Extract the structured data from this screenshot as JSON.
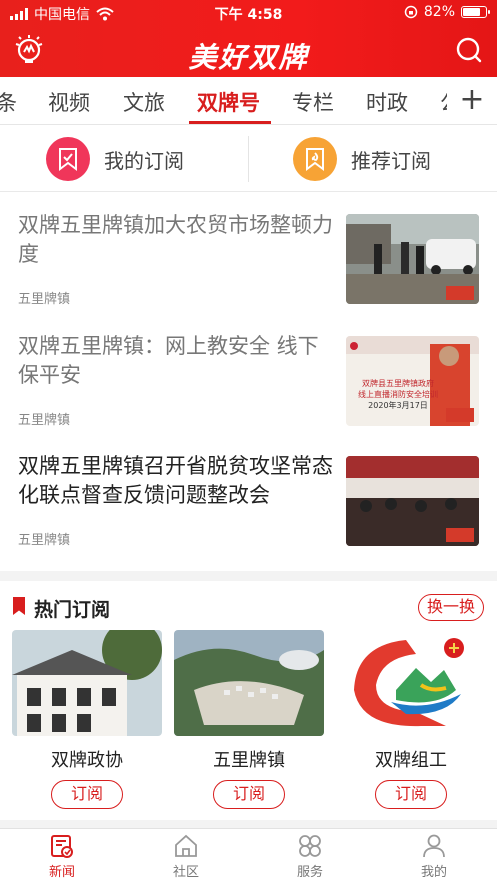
{
  "status_bar": {
    "carrier": "中国电信",
    "time": "下午 4:58",
    "battery": "82%",
    "battery_level": 0.82
  },
  "header": {
    "brand": "美好双牌",
    "left_icon": "lightbulb-logo-icon",
    "right_icon": "search-icon",
    "accent_color": "#e8201c"
  },
  "tabs": {
    "items": [
      "条",
      "视频",
      "文旅",
      "双牌号",
      "专栏",
      "时政",
      "公"
    ],
    "active": "双牌号",
    "add_label": "+"
  },
  "subscribe_bar": {
    "mine": "我的订阅",
    "recommend": "推荐订阅"
  },
  "news": [
    {
      "title": "双牌五里牌镇加大农贸市场整顿力度",
      "source": "五里牌镇",
      "read": true
    },
    {
      "title": "双牌五里牌镇：网上教安全 线下保平安",
      "source": "五里牌镇",
      "read": true,
      "thumb_text": [
        "双牌县五里牌镇政府",
        "线上直播消防安全培训",
        "2020年3月17日"
      ]
    },
    {
      "title": "双牌五里牌镇召开省脱贫攻坚常态化联点督查反馈问题整改会",
      "source": "五里牌镇",
      "read": false
    }
  ],
  "hot": {
    "title": "热门订阅",
    "swap": "换一换",
    "cards": [
      {
        "name": "双牌政协",
        "button": "订阅"
      },
      {
        "name": "五里牌镇",
        "button": "订阅"
      },
      {
        "name": "双牌组工",
        "button": "订阅"
      }
    ]
  },
  "bottom_nav": {
    "items": [
      {
        "label": "新闻",
        "icon": "news-icon"
      },
      {
        "label": "社区",
        "icon": "house-icon"
      },
      {
        "label": "服务",
        "icon": "grid-flower-icon"
      },
      {
        "label": "我的",
        "icon": "person-icon"
      }
    ],
    "active": "新闻"
  }
}
